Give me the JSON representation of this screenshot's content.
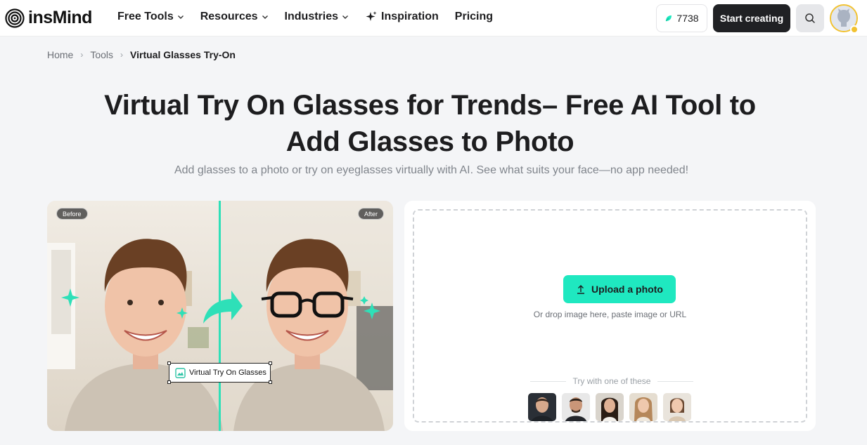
{
  "header": {
    "logo_text": "insMind",
    "nav": [
      {
        "label": "Free Tools",
        "dropdown": true
      },
      {
        "label": "Resources",
        "dropdown": true
      },
      {
        "label": "Industries",
        "dropdown": true
      },
      {
        "label": "Inspiration",
        "icon": "sparkle-icon"
      },
      {
        "label": "Pricing"
      }
    ],
    "credits": "7738",
    "start_button": "Start creating"
  },
  "breadcrumb": [
    "Home",
    "Tools",
    "Virtual Glasses Try-On"
  ],
  "hero": {
    "title_line1": "Virtual Try On Glasses for Trends– Free AI Tool to",
    "title_line2": "Add Glasses to Photo",
    "subtitle": "Add glasses to a photo or try on eyeglasses virtually with AI. See what suits your face—no app needed!"
  },
  "demo": {
    "before_label": "Before",
    "after_label": "After",
    "tag_label": "Virtual Try On Glasses"
  },
  "upload": {
    "button_label": "Upload a photo",
    "hint": "Or drop image here, paste image or URL",
    "try_label": "Try with one of these"
  },
  "colors": {
    "accent": "#1fe8c0",
    "dark_button": "#202124",
    "avatar_ring": "#f2c230"
  }
}
